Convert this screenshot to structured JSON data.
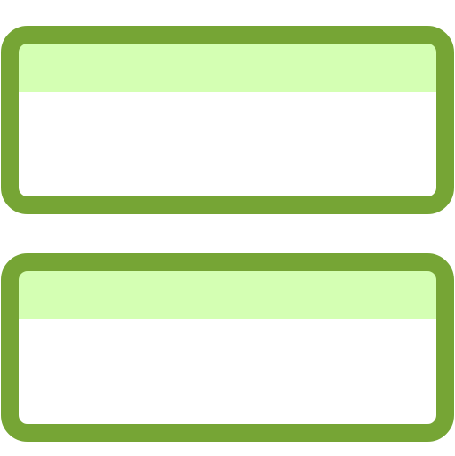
{
  "icon": {
    "name": "two-panels-icon",
    "colors": {
      "stroke": "#76a535",
      "header_fill": "#d4ffb3",
      "body_fill": "#ffffff",
      "background": "#ffffff"
    },
    "panels": [
      {
        "name": "top-panel"
      },
      {
        "name": "bottom-panel"
      }
    ]
  }
}
